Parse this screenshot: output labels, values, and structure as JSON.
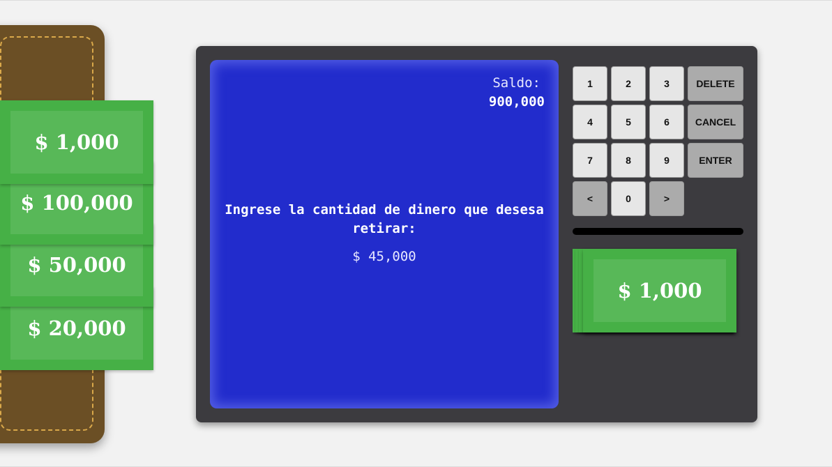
{
  "wallet": {
    "bills": [
      {
        "label": "$ 1,000"
      },
      {
        "label": "$ 100,000"
      },
      {
        "label": "$ 50,000"
      },
      {
        "label": "$ 20,000"
      }
    ]
  },
  "atm": {
    "screen": {
      "balance_label": "Saldo:",
      "balance_value": "900,000",
      "prompt": "Ingrese la cantidad de dinero que desesa retirar:",
      "amount": "$ 45,000"
    },
    "keypad": {
      "keys": [
        "1",
        "2",
        "3",
        "4",
        "5",
        "6",
        "7",
        "8",
        "9",
        "<",
        "0",
        ">"
      ],
      "delete_label": "DELETE",
      "cancel_label": "CANCEL",
      "enter_label": "ENTER"
    },
    "dispenser": {
      "bill_label": "$ 1,000"
    }
  },
  "colors": {
    "screen": "#222ccc",
    "bill": "#46b046",
    "bill_inner": "#58b858",
    "wallet": "#6b4f25",
    "atm_body": "#3c3b3f"
  }
}
